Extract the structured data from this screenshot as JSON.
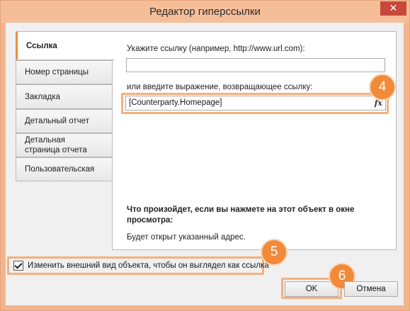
{
  "window": {
    "title": "Редактор гиперссылки",
    "close_glyph": "✕"
  },
  "tabs": [
    {
      "label": "Ссылка",
      "active": true
    },
    {
      "label": "Номер страницы",
      "active": false
    },
    {
      "label": "Закладка",
      "active": false
    },
    {
      "label": "Детальный отчет",
      "active": false
    },
    {
      "label": "Детальная страница отчета",
      "active": false
    },
    {
      "label": "Пользовательская",
      "active": false
    }
  ],
  "panel": {
    "url_prompt": "Укажите ссылку (например, http://www.url.com):",
    "url_value": "",
    "expression_prompt": "или введите выражение, возвращающее ссылку:",
    "expression_value": "[Counterparty.Homepage]",
    "expression_button_icon": "fx-icon",
    "expression_button_glyph": "fx",
    "what_happens_heading": "Что произойдет, если вы нажмете на этот объект в окне просмотра:",
    "what_happens_text": "Будет открыт указанный адрес."
  },
  "checkbox": {
    "label": "Изменить внешний вид объекта, чтобы он выглядел как ссылка",
    "checked": true
  },
  "buttons": {
    "ok_label": "OK",
    "cancel_label": "Отмена"
  },
  "callouts": {
    "badge_4": "4",
    "badge_5": "5",
    "badge_6": "6",
    "color": "#f28a3a"
  }
}
